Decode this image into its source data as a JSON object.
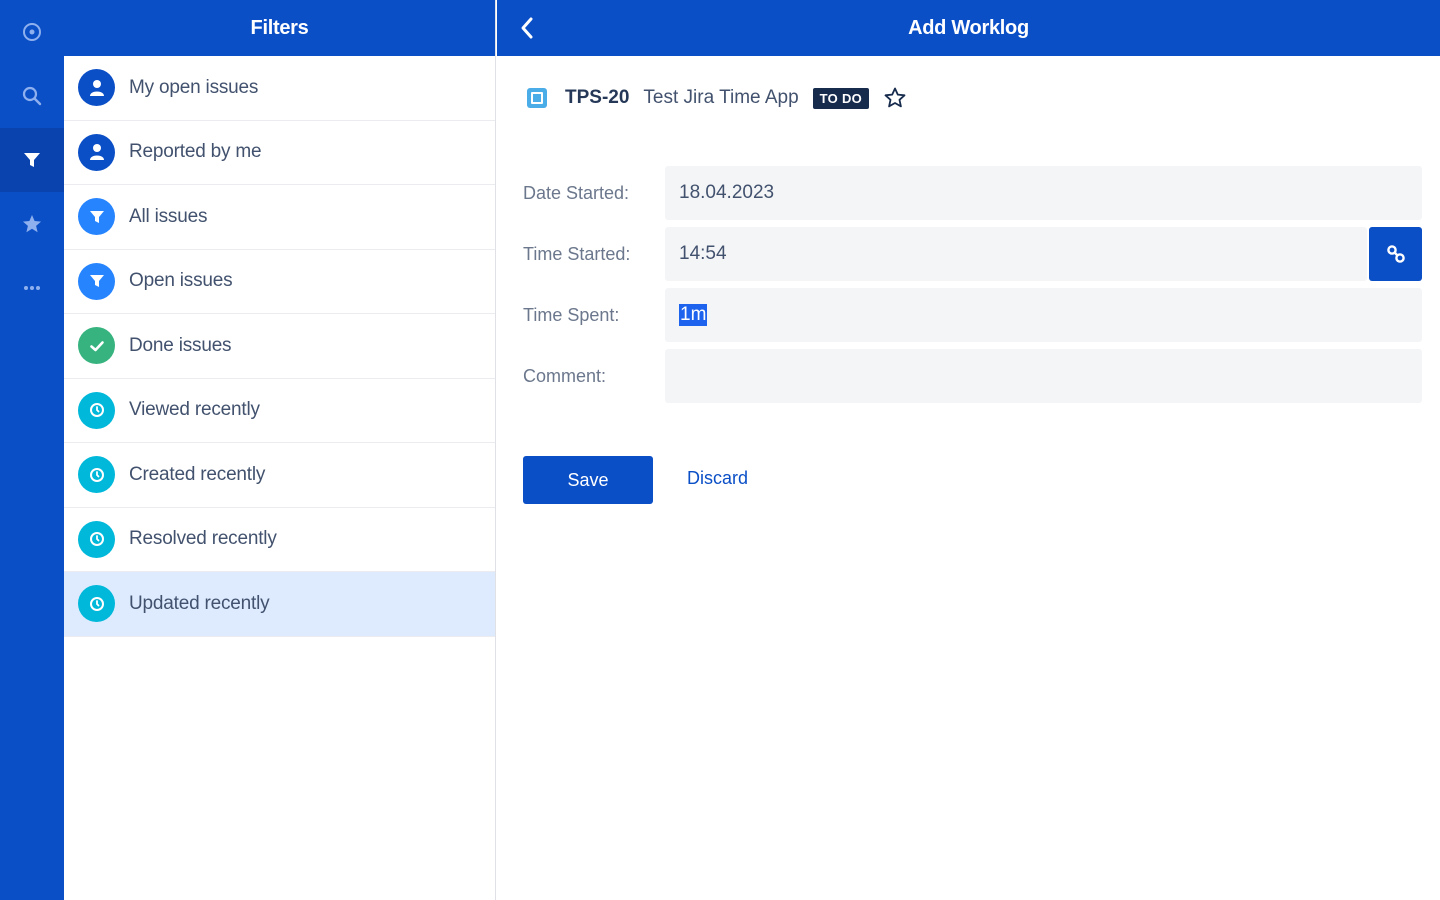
{
  "rail": {
    "items": [
      {
        "icon": "issues-icon",
        "active": false
      },
      {
        "icon": "search-icon",
        "active": false
      },
      {
        "icon": "filter-icon",
        "active": true
      },
      {
        "icon": "star-icon",
        "active": false
      },
      {
        "icon": "more-icon",
        "active": false
      }
    ]
  },
  "filters": {
    "title": "Filters",
    "items": [
      {
        "label": "My open issues",
        "icon": "user-icon",
        "color": "#0b4fc7"
      },
      {
        "label": "Reported by me",
        "icon": "user-icon",
        "color": "#0b4fc7"
      },
      {
        "label": "All issues",
        "icon": "filter-icon",
        "color": "#2684ff"
      },
      {
        "label": "Open issues",
        "icon": "filter-icon",
        "color": "#2684ff"
      },
      {
        "label": "Done issues",
        "icon": "check-icon",
        "color": "#36b37e"
      },
      {
        "label": "Viewed recently",
        "icon": "clock-icon",
        "color": "#00b8d9"
      },
      {
        "label": "Created recently",
        "icon": "clock-icon",
        "color": "#00b8d9"
      },
      {
        "label": "Resolved recently",
        "icon": "clock-icon",
        "color": "#00b8d9"
      },
      {
        "label": "Updated recently",
        "icon": "clock-icon",
        "color": "#00b8d9",
        "selected": true
      }
    ]
  },
  "main": {
    "title": "Add Worklog",
    "issue": {
      "key": "TPS-20",
      "title": "Test Jira Time App",
      "status": "TO DO"
    },
    "form": {
      "date_label": "Date Started:",
      "date_value": "18.04.2023",
      "time_label": "Time Started:",
      "time_value": "14:54",
      "spent_label": "Time Spent:",
      "spent_value": "1m",
      "comment_label": "Comment:",
      "comment_value": ""
    },
    "save_label": "Save",
    "discard_label": "Discard"
  },
  "colors": {
    "brand": "#0b4fc7",
    "selected_row": "#deebff",
    "status_badge": "#172b4d"
  }
}
